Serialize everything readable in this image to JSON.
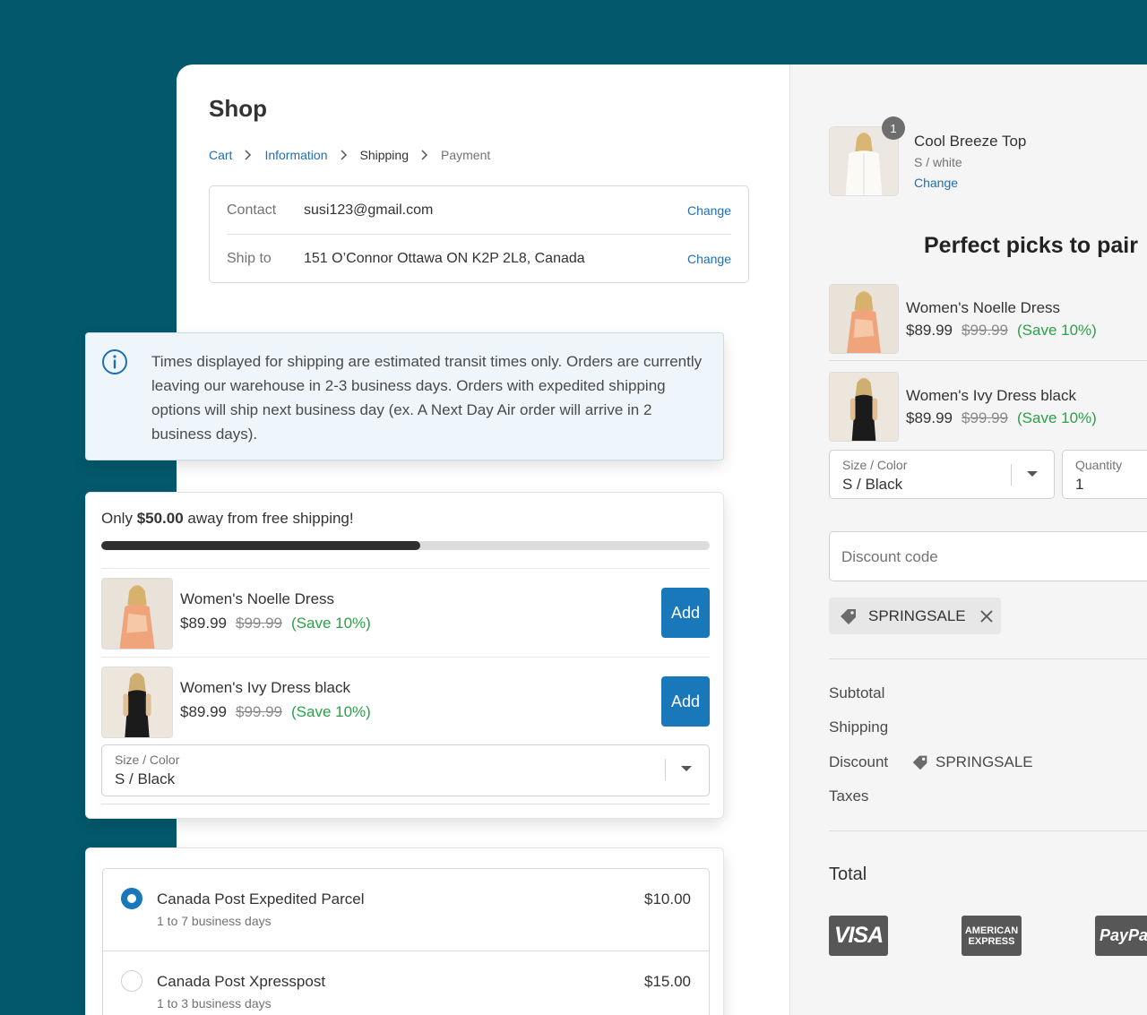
{
  "shop": {
    "title": "Shop"
  },
  "breadcrumb": [
    "Cart",
    "Information",
    "Shipping",
    "Payment"
  ],
  "review": {
    "contact_label": "Contact",
    "contact_value": "susi123@gmail.com",
    "ship_label": "Ship to",
    "ship_value": "151 O’Connor Ottawa ON K2P 2L8, Canada",
    "change_label": "Change"
  },
  "notice": {
    "icon": "info-icon",
    "text": "Times displayed for shipping are estimated transit times only. Orders are currently leaving our warehouse in 2-3 business days. Orders with expedited shipping options will ship next business day (ex. A Next Day Air order will arrive in 2 business days)."
  },
  "free_shipping": {
    "prefix": "Only ",
    "amount": "$50.00",
    "suffix": " away from free shipping!",
    "progress_fraction": 0.524
  },
  "upsell": {
    "items": [
      {
        "name": "Women's Noelle Dress",
        "price": "$89.99",
        "was": "$99.99",
        "save": "(Save 10%)",
        "button": "Add"
      },
      {
        "name": "Women's Ivy Dress black",
        "price": "$89.99",
        "was": "$99.99",
        "save": "(Save 10%)",
        "button": "Add"
      }
    ],
    "select_label": "Size / Color",
    "select_value": "S / Black"
  },
  "shipping_options": [
    {
      "name": "Canada Post Expedited Parcel",
      "eta": "1 to 7 business days",
      "price": "$10.00",
      "selected": true
    },
    {
      "name": "Canada Post Xpresspost",
      "eta": "1 to 3 business days",
      "price": "$15.00",
      "selected": false
    }
  ],
  "cart": {
    "quantity_badge": "1",
    "name": "Cool Breeze Top",
    "variant": "S / white",
    "change": "Change"
  },
  "pairs": {
    "title": "Perfect picks to pair",
    "items": [
      {
        "name": "Women's Noelle Dress",
        "price": "$89.99",
        "was": "$99.99",
        "save": "(Save 10%)"
      },
      {
        "name": "Women's Ivy Dress black",
        "price": "$89.99",
        "was": "$99.99",
        "save": "(Save 10%)"
      }
    ],
    "size_label": "Size / Color",
    "size_value": "S / Black",
    "qty_label": "Quantity",
    "qty_value": "1"
  },
  "discount": {
    "placeholder": "Discount code",
    "applied_code": "SPRINGSALE"
  },
  "summary": {
    "subtotal": "Subtotal",
    "shipping": "Shipping",
    "discount": "Discount",
    "discount_code": "SPRINGSALE",
    "taxes": "Taxes",
    "total": "Total"
  },
  "payment_logos": {
    "visa": "VISA",
    "amex_line1": "AMERICAN",
    "amex_line2": "EXPRESS",
    "paypal": "PayPal"
  },
  "colors": {
    "brand_bg": "#03596b",
    "accent": "#1878b9",
    "save_green": "#2aa147"
  }
}
